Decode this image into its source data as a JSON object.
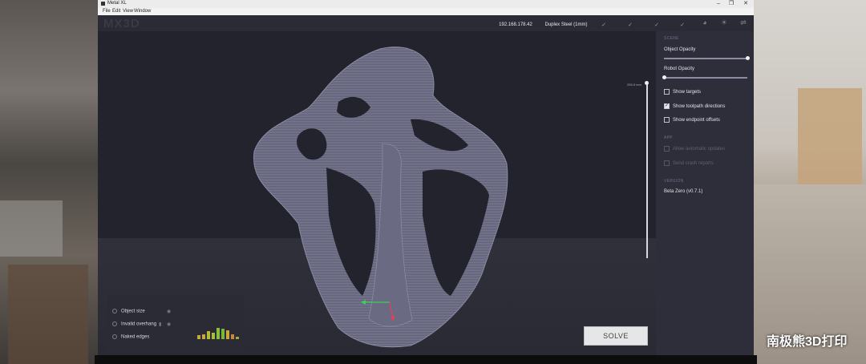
{
  "window": {
    "title": "Metal XL",
    "menu": [
      "File",
      "Edit",
      "View",
      "Window"
    ],
    "controls": [
      "–",
      "❐",
      "✕"
    ]
  },
  "header": {
    "logo": "MX3D",
    "ip_value": "192.168.178.42",
    "material_value": "Duplex Steel (1mm)",
    "status_checks": [
      "✓",
      "✓",
      "✓",
      "✓"
    ]
  },
  "viewport": {
    "slider_label": "255.5 mm"
  },
  "panel": {
    "items": [
      {
        "label": "Object size"
      },
      {
        "label": "Invalid overhang"
      },
      {
        "label": "Naked edges"
      }
    ],
    "bars": [
      0.3,
      0.4,
      0.6,
      0.5,
      0.9,
      0.8,
      0.7,
      0.4,
      0.2
    ],
    "bar_colors": [
      "#c8a838",
      "#c8a838",
      "#b8b838",
      "#a8c038",
      "#88c038",
      "#78b838",
      "#c8a838",
      "#c88838",
      "#a8a838"
    ]
  },
  "actions": {
    "solve_label": "SOLVE"
  },
  "sidebar": {
    "scene_cap": "SCENE",
    "object_opacity_label": "Object Opacity",
    "object_opacity_value": 1.0,
    "robot_opacity_label": "Robot Opacity",
    "robot_opacity_value": 0.0,
    "checks": [
      {
        "label": "Show targets",
        "checked": false
      },
      {
        "label": "Show toolpath directions",
        "checked": true
      },
      {
        "label": "Show endpoint offsets",
        "checked": false
      }
    ],
    "app_cap": "APP",
    "app_checks": [
      {
        "label": "Allow automatic updates",
        "checked": false
      },
      {
        "label": "Send crash reports",
        "checked": false
      }
    ],
    "version_cap": "VERSION",
    "version_value": "Beta Zero (v0.7.1)"
  },
  "overlay": {
    "watermark": "南极熊3D打印"
  },
  "colors": {
    "app_bg": "#25252f",
    "sidebar_bg": "#2e2e3a",
    "model": "#6e6e84"
  }
}
